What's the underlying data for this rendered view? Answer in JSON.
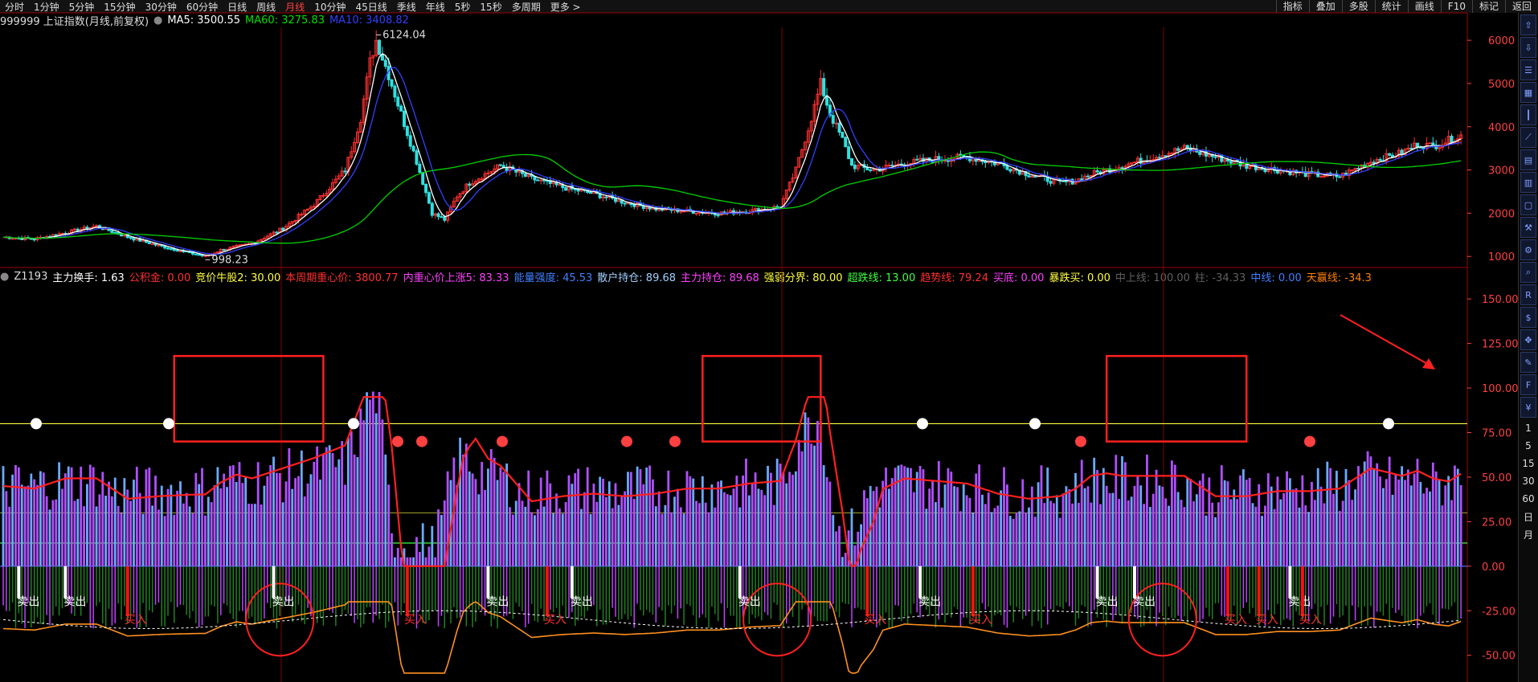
{
  "topbar": {
    "tabs": [
      "分时",
      "1分钟",
      "5分钟",
      "15分钟",
      "30分钟",
      "60分钟",
      "日线",
      "周线",
      "月线",
      "10分钟",
      "45日线",
      "季线",
      "年线",
      "5秒",
      "15秒",
      "多周期",
      "更多 >"
    ],
    "active_tab": "月线",
    "tools": [
      "指标",
      "叠加",
      "多股",
      "统计",
      "画线",
      "F10",
      "标记",
      "返回"
    ]
  },
  "main_header": {
    "symbol": "999999 上证指数(月线,前复权)",
    "ma5_label": "MA5: 3500.55",
    "ma60_label": "MA60: 3275.83",
    "ma10_label": "MA10: 3408.82",
    "colors": {
      "ma5": "#ffffff",
      "ma60": "#00e000",
      "ma10": "#3040ff"
    }
  },
  "ind_header": {
    "name": "Z1193",
    "items": [
      {
        "label": "主力换手: 1.63",
        "color": "#ffffff"
      },
      {
        "label": "公积金: 0.00",
        "color": "#ff3030"
      },
      {
        "label": "竞价牛股2: 30.00",
        "color": "#ffff40"
      },
      {
        "label": "本周期重心价: 3800.77",
        "color": "#ff3030"
      },
      {
        "label": "内重心价上涨5: 83.33",
        "color": "#ff40ff"
      },
      {
        "label": "能量强度: 45.53",
        "color": "#4080ff"
      },
      {
        "label": "散户持仓: 89.68",
        "color": "#a0d0ff"
      },
      {
        "label": "主力持仓: 89.68",
        "color": "#ff40ff"
      },
      {
        "label": "强弱分界: 80.00",
        "color": "#ffff40"
      },
      {
        "label": "超跌线: 13.00",
        "color": "#40ff40"
      },
      {
        "label": "趋势线: 79.24",
        "color": "#ff3030"
      },
      {
        "label": "买底: 0.00",
        "color": "#ff40ff"
      },
      {
        "label": "暴跌买: 0.00",
        "color": "#ffff40"
      },
      {
        "label": "中上线: 100.00",
        "color": "#606060"
      },
      {
        "label": "柱: -34.33",
        "color": "#606060"
      },
      {
        "label": "中线: 0.00",
        "color": "#4080ff"
      },
      {
        "label": "天赢线: -34.3",
        "color": "#ff8000"
      }
    ]
  },
  "annotations": {
    "high_label": "6124.04",
    "low_label": "998.23",
    "sell_label": "卖出",
    "buy_label": "买入"
  },
  "sidebar": {
    "icons": [
      "arrow-up-icon",
      "arrow-down-icon",
      "list-icon",
      "grid-icon",
      "candle-icon",
      "line-icon",
      "chart-icon",
      "bar-icon",
      "window-icon",
      "tool-icon",
      "settings-icon",
      "search-icon",
      "rsi-icon",
      "dollar-icon",
      "move-icon",
      "pen-icon",
      "fs-icon",
      "money-icon"
    ],
    "numbers": [
      "1",
      "5",
      "15",
      "30",
      "60",
      "日",
      "月"
    ]
  },
  "chart_data": [
    {
      "type": "candlestick",
      "title": "999999 上证指数(月线,前复权)",
      "y_ticks": [
        1000,
        2000,
        3000,
        4000,
        5000,
        6000
      ],
      "ylim": [
        800,
        6300
      ],
      "annotations": [
        {
          "text": "6124.04",
          "value": 6124.04
        },
        {
          "text": "998.23",
          "value": 998.23
        }
      ],
      "series": [
        {
          "name": "MA5"
        },
        {
          "name": "MA10"
        },
        {
          "name": "MA60"
        }
      ],
      "close_path": [
        [
          0,
          1450
        ],
        [
          10,
          1400
        ],
        [
          20,
          1550
        ],
        [
          30,
          1700
        ],
        [
          40,
          1450
        ],
        [
          50,
          1250
        ],
        [
          60,
          1080
        ],
        [
          65,
          1000
        ],
        [
          70,
          1150
        ],
        [
          80,
          1300
        ],
        [
          90,
          1650
        ],
        [
          100,
          2200
        ],
        [
          110,
          3000
        ],
        [
          115,
          4200
        ],
        [
          118,
          5500
        ],
        [
          120,
          6000
        ],
        [
          124,
          5200
        ],
        [
          128,
          4300
        ],
        [
          133,
          3200
        ],
        [
          138,
          2000
        ],
        [
          142,
          1850
        ],
        [
          146,
          2400
        ],
        [
          150,
          2700
        ],
        [
          155,
          2900
        ],
        [
          160,
          3100
        ],
        [
          170,
          2800
        ],
        [
          180,
          2600
        ],
        [
          190,
          2450
        ],
        [
          200,
          2250
        ],
        [
          210,
          2100
        ],
        [
          220,
          2050
        ],
        [
          230,
          2000
        ],
        [
          240,
          2050
        ],
        [
          250,
          2150
        ],
        [
          255,
          3000
        ],
        [
          260,
          4200
        ],
        [
          263,
          5000
        ],
        [
          266,
          4300
        ],
        [
          270,
          3700
        ],
        [
          273,
          3100
        ],
        [
          280,
          3000
        ],
        [
          290,
          3150
        ],
        [
          300,
          3250
        ],
        [
          310,
          3300
        ],
        [
          320,
          3150
        ],
        [
          330,
          2900
        ],
        [
          340,
          2700
        ],
        [
          345,
          2750
        ],
        [
          350,
          2900
        ],
        [
          360,
          3100
        ],
        [
          370,
          3300
        ],
        [
          380,
          3500
        ],
        [
          390,
          3300
        ],
        [
          400,
          3100
        ],
        [
          410,
          3000
        ],
        [
          420,
          2900
        ],
        [
          430,
          2850
        ],
        [
          440,
          3200
        ],
        [
          450,
          3400
        ],
        [
          455,
          3600
        ],
        [
          460,
          3550
        ],
        [
          469,
          3800
        ]
      ]
    },
    {
      "type": "indicator",
      "y_ticks": [
        -50.0,
        -25.0,
        0.0,
        25.0,
        50.0,
        75.0,
        100.0,
        125.0,
        150.0
      ],
      "ylim": [
        -65,
        160
      ],
      "hlines": [
        {
          "value": 0,
          "color": "#4070ff"
        },
        {
          "value": 13,
          "color": "#40ff40"
        },
        {
          "value": 80,
          "color": "#ffff40"
        }
      ],
      "sell_signals": [
        5,
        20,
        87,
        156,
        183,
        237,
        295,
        352,
        364,
        414
      ],
      "buy_signals": [
        40,
        130,
        175,
        278,
        312,
        394,
        404,
        418
      ],
      "highlight_boxes": [
        [
          55,
          103
        ],
        [
          225,
          263
        ],
        [
          355,
          400
        ]
      ],
      "highlight_circles": [
        89,
        249,
        373
      ]
    }
  ]
}
